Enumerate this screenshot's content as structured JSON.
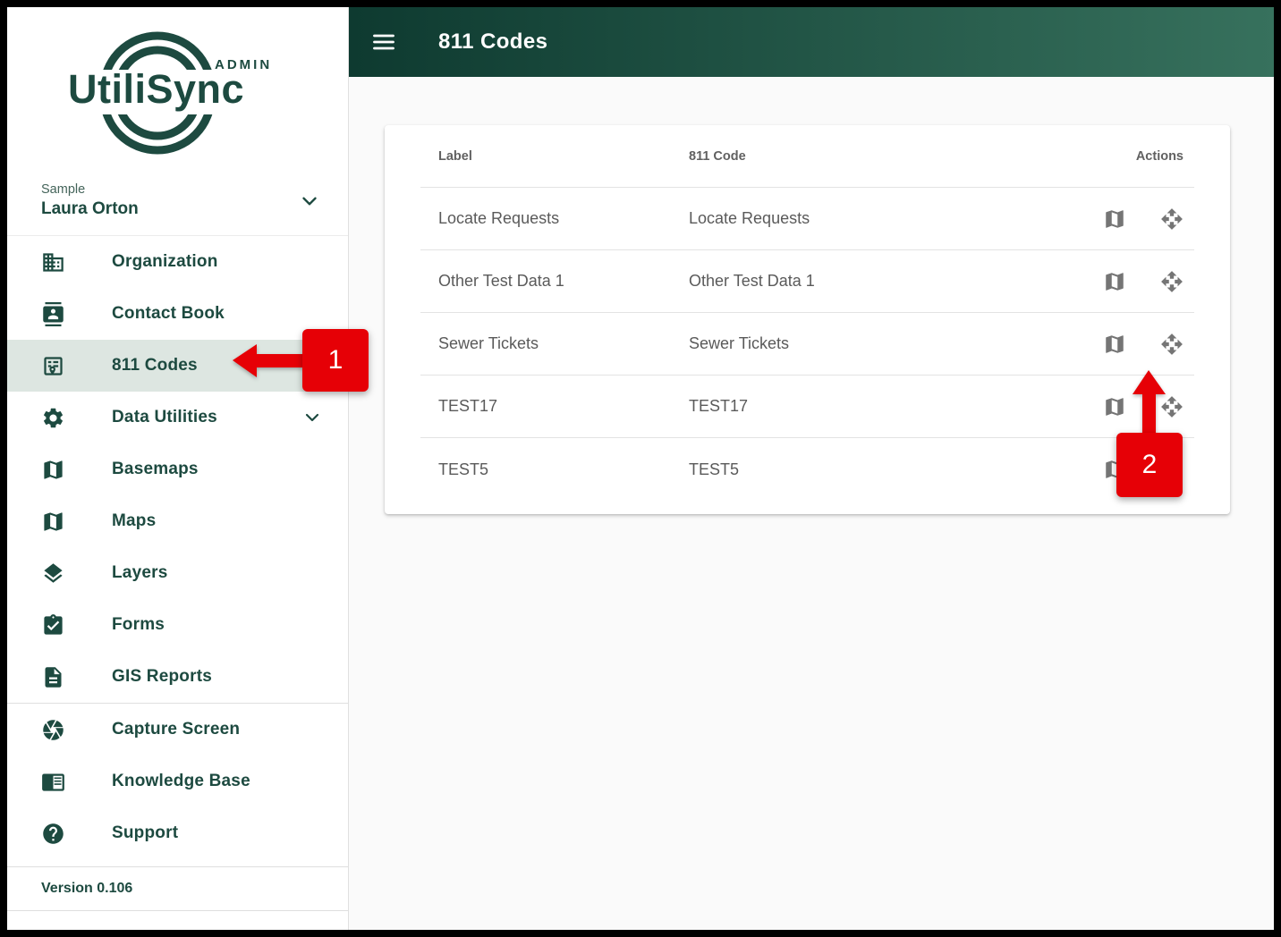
{
  "app": {
    "brand": "UtiliSync",
    "brand_badge": "ADMIN",
    "version": "Version 0.106"
  },
  "account": {
    "org": "Sample",
    "user": "Laura Orton"
  },
  "sidebar": {
    "items": [
      {
        "label": "Organization",
        "icon": "building-icon",
        "selected": false
      },
      {
        "label": "Contact Book",
        "icon": "contact-card-icon",
        "selected": false
      },
      {
        "label": "811 Codes",
        "icon": "list-location-icon",
        "selected": true
      },
      {
        "label": "Data Utilities",
        "icon": "gear-icon",
        "selected": false,
        "expandable": true
      },
      {
        "label": "Basemaps",
        "icon": "basemap-icon",
        "selected": false
      },
      {
        "label": "Maps",
        "icon": "map-icon",
        "selected": false
      },
      {
        "label": "Layers",
        "icon": "layers-icon",
        "selected": false
      },
      {
        "label": "Forms",
        "icon": "clipboard-check-icon",
        "selected": false
      },
      {
        "label": "GIS Reports",
        "icon": "document-icon",
        "selected": false
      },
      {
        "label": "Capture Screen",
        "icon": "shutter-icon",
        "selected": false
      },
      {
        "label": "Knowledge Base",
        "icon": "reader-icon",
        "selected": false
      },
      {
        "label": "Support",
        "icon": "help-icon",
        "selected": false
      }
    ]
  },
  "header": {
    "title": "811 Codes",
    "menu_icon": "hamburger-icon"
  },
  "table": {
    "columns": {
      "label": "Label",
      "code": "811 Code",
      "actions": "Actions"
    },
    "row_action_icons": [
      "map-icon",
      "move-arrows-icon"
    ],
    "rows": [
      {
        "label": "Locate Requests",
        "code": "Locate Requests"
      },
      {
        "label": "Other Test Data 1",
        "code": "Other Test Data 1"
      },
      {
        "label": "Sewer Tickets",
        "code": "Sewer Tickets"
      },
      {
        "label": "TEST17",
        "code": "TEST17"
      },
      {
        "label": "TEST5",
        "code": "TEST5"
      }
    ]
  },
  "annotations": {
    "step_1": "1",
    "step_2": "2"
  },
  "colors": {
    "brand_dark_green": "#1d4a40",
    "header_gradient_left": "#0e3a30",
    "header_gradient_right": "#37715d",
    "selected_item_bg": "#dde6e1",
    "annotation_red": "#e60006",
    "action_icon_gray": "#757575",
    "table_text_gray": "#5a5a5a"
  }
}
